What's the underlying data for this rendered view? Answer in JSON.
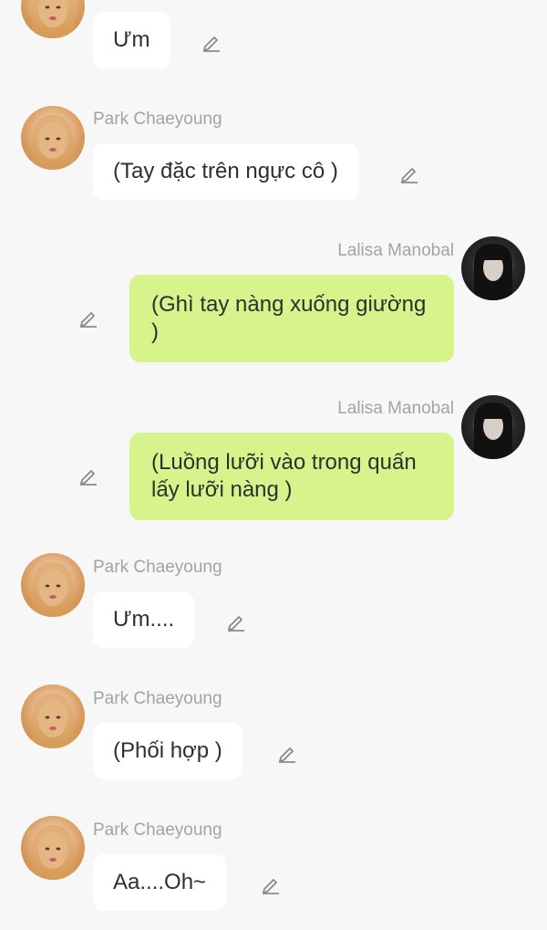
{
  "messages": [
    {
      "sender": "",
      "text": "Ưm",
      "side": "left"
    },
    {
      "sender": "Park Chaeyoung",
      "text": "(Tay đặc trên ngực cô )",
      "side": "left"
    },
    {
      "sender": "Lalisa Manobal",
      "text": "(Ghì tay nàng xuống giường )",
      "side": "right"
    },
    {
      "sender": "Lalisa Manobal",
      "text": "(Luồng lưỡi vào trong quấn lấy lưỡi nàng )",
      "side": "right"
    },
    {
      "sender": "Park Chaeyoung",
      "text": "Ưm....",
      "side": "left"
    },
    {
      "sender": "Park Chaeyoung",
      "text": "(Phối hợp )",
      "side": "left"
    },
    {
      "sender": "Park Chaeyoung",
      "text": "Aa....Oh~",
      "side": "left"
    }
  ],
  "icons": {
    "avatar_left": "avatar",
    "avatar_right": "avatar",
    "edit": "pencil-edit-icon"
  },
  "colors": {
    "background": "#f7f7f7",
    "bubble_left": "#ffffff",
    "bubble_right": "#d7f48c",
    "sender_name": "#a3a3a3",
    "text": "#2f2f2f"
  }
}
